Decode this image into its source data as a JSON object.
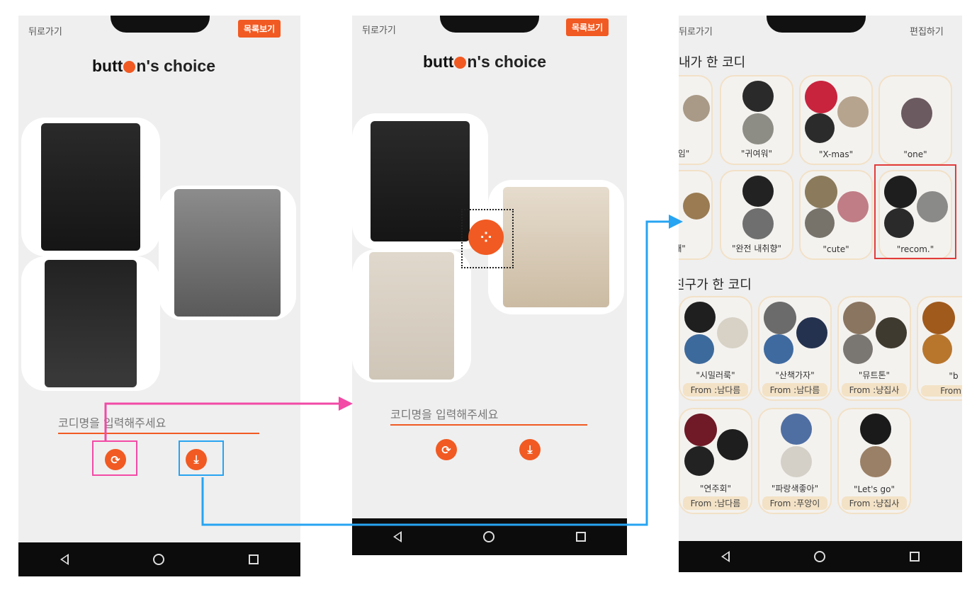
{
  "screen1": {
    "back": "뒤로가기",
    "list_button": "목록보기",
    "brand_a": "butt",
    "brand_b": "n's choice",
    "input_placeholder": "코디명을 입력해주세요"
  },
  "screen2": {
    "back": "뒤로가기",
    "list_button": "목록보기",
    "brand_a": "butt",
    "brand_b": "n's choice",
    "input_placeholder": "코디명을 입력해주세요"
  },
  "screen3": {
    "back": "뒤로가기",
    "edit": "편집하기",
    "my_title": "내가 한 코디",
    "friend_title": "친구가 한 코디",
    "my_cards": [
      "유행임\"",
      "\"귀여워\"",
      "\"X-mas\"",
      "\"one\"",
      "날때\"",
      "\"완전 내취향\"",
      "\"cute\"",
      "\"recom.\""
    ],
    "friend_cards": [
      {
        "label": "\"시밀러룩\"",
        "from": "From :남다름"
      },
      {
        "label": "\"산책가자\"",
        "from": "From :남다름"
      },
      {
        "label": "\"뮤트톤\"",
        "from": "From :냥집사"
      },
      {
        "label": "\"b",
        "from": "From :"
      },
      {
        "label": "\"연주회\"",
        "from": "From :남다름"
      },
      {
        "label": "\"파랑색좋아\"",
        "from": "From :푸앙이"
      },
      {
        "label": "\"Let's go\"",
        "from": "From :냥집사"
      }
    ]
  },
  "colors": {
    "accent": "#f15a22",
    "pink": "#f24aa6",
    "blue": "#27a4f2",
    "red": "#e23b3b"
  }
}
